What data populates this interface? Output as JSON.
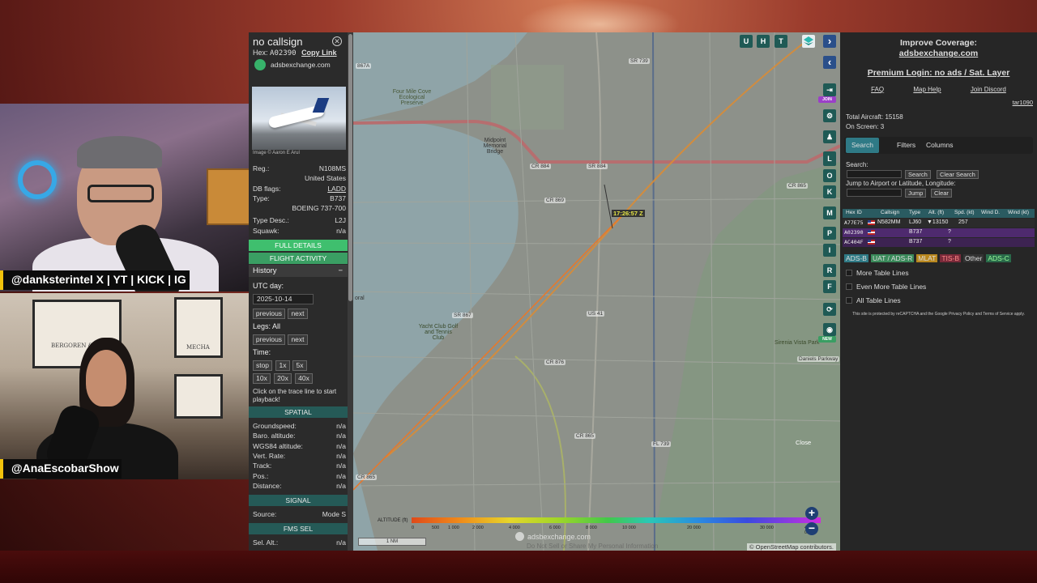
{
  "stream": {
    "cam1_tag": "@danksterintel X | YT | KICK | IG",
    "cam2_tag": "@AnaEscobarShow",
    "frame_texts": [
      "BERGOREN & CIE",
      "MECHA"
    ]
  },
  "details": {
    "title": "no callsign",
    "hex_label": "Hex:",
    "hex": "A02390",
    "copy_link": "Copy Link",
    "site": "adsbexchange.com",
    "photo_credit": "Image © Aaron E Arul",
    "reg_label": "Reg.:",
    "reg": "N108MS",
    "country": "United States",
    "dbflags_label": "DB flags:",
    "dbflags": "LADD",
    "type_label": "Type:",
    "type": "B737",
    "type_full": "BOEING 737-700",
    "typedesc_label": "Type Desc.:",
    "typedesc": "L2J",
    "squawk_label": "Squawk:",
    "squawk": "n/a",
    "full_details": "FULL DETAILS",
    "flight_activity": "FLIGHT ACTIVITY",
    "history": "History",
    "utc_day_label": "UTC day:",
    "utc_day": "2025-10-14",
    "prev1": "previous",
    "next1": "next",
    "legs_label": "Legs: All",
    "prev2": "previous",
    "next2": "next",
    "time_label": "Time:",
    "speed_buttons": [
      "stop",
      "1x",
      "5x",
      "10x",
      "20x",
      "40x"
    ],
    "trace_note": "Click on the trace line to start playback!",
    "spatial": "SPATIAL",
    "spatial_rows": [
      {
        "k": "Groundspeed:",
        "v": "n/a"
      },
      {
        "k": "Baro. altitude:",
        "v": "n/a"
      },
      {
        "k": "WGS84 altitude:",
        "v": "n/a"
      },
      {
        "k": "Vert. Rate:",
        "v": "n/a"
      },
      {
        "k": "Track:",
        "v": "n/a"
      },
      {
        "k": "Pos.:",
        "v": "n/a"
      },
      {
        "k": "Distance:",
        "v": "n/a"
      }
    ],
    "signal": "SIGNAL",
    "source_label": "Source:",
    "source": "Mode S",
    "fms_sel": "FMS SEL",
    "sel_alt_label": "Sel. Alt.:",
    "sel_alt": "n/a"
  },
  "map": {
    "top_buttons": [
      "U",
      "H",
      "T"
    ],
    "side_buttons": [
      "L",
      "O",
      "K",
      "M",
      "P",
      "I",
      "R",
      "F"
    ],
    "join_badge": "JOIN",
    "new_badge": "NEW",
    "timestamp": "17:26:57 Z",
    "labels": {
      "bridge": "Midpoint Memorial Bridge",
      "coral": "oral",
      "area1": "Four Mile Cove Ecological Preserve",
      "area2": "Sirenia Vista Park",
      "area3": "Yacht Club Golf and Tennis Club",
      "close": "Close"
    },
    "shields": [
      "CR 884",
      "SR 884",
      "CR 869",
      "CR 865",
      "SR 867",
      "US 41",
      "CR 876",
      "CR 865",
      "FL 739",
      "CR 865",
      "SR 739",
      "867A",
      "Daniels Parkway"
    ],
    "altitude_title": "ALTITUDE (ft)",
    "altitude_ticks": [
      "0",
      "500",
      "1 000",
      "2 000",
      "4 000",
      "6 000",
      "8 000",
      "10 000",
      "20 000",
      "30 000",
      "40 000+"
    ],
    "scale": "1 NM",
    "watermark": "adsbexchange.com",
    "privacy": "Do Not Sell or Share My Personal Information",
    "osm": "© OpenStreetMap contributors.",
    "colors": {
      "flight_track": "#e8782a",
      "route_line": "#d9a23a",
      "highway": "#b86a6a"
    }
  },
  "right": {
    "coverage_1": "Improve Coverage:",
    "coverage_2": "adsbexchange.com",
    "premium": "Premium Login: no ads / Sat. Layer",
    "links": [
      "FAQ",
      "Map Help",
      "Join Discord"
    ],
    "user": "tar1090",
    "total_aircraft": "Total Aircraft: 15158",
    "on_screen": "On Screen: 3",
    "tabs": [
      "Search",
      "Filters",
      "Columns"
    ],
    "search_label": "Search:",
    "search_btn": "Search",
    "clear_search_btn": "Clear Search",
    "jump_label": "Jump to Airport or Latitude, Longitude:",
    "jump_btn": "Jump",
    "clear_btn": "Clear",
    "columns": [
      "Hex ID",
      "Callsign",
      "Type",
      "Alt. (ft)",
      "Spd. (kt)",
      "Wind D.",
      "Wind (kt)"
    ],
    "rows": [
      {
        "hex": "A77E75",
        "callsign": "N582MM",
        "type": "LJ60",
        "alt": "▼13150",
        "spd": "257"
      },
      {
        "hex": "A02390",
        "callsign": "",
        "type": "B737",
        "alt": "?",
        "spd": ""
      },
      {
        "hex": "AC404F",
        "callsign": "",
        "type": "B737",
        "alt": "?",
        "spd": ""
      }
    ],
    "sources": [
      "ADS-B",
      "UAT / ADS-R",
      "MLAT",
      "TIS-B",
      "Other",
      "ADS-C"
    ],
    "checks": [
      "More Table Lines",
      "Even More Table Lines",
      "All Table Lines"
    ],
    "recaptcha": "This site is protected by reCAPTCHA and the Google Privacy Policy and Terms of Service apply."
  }
}
